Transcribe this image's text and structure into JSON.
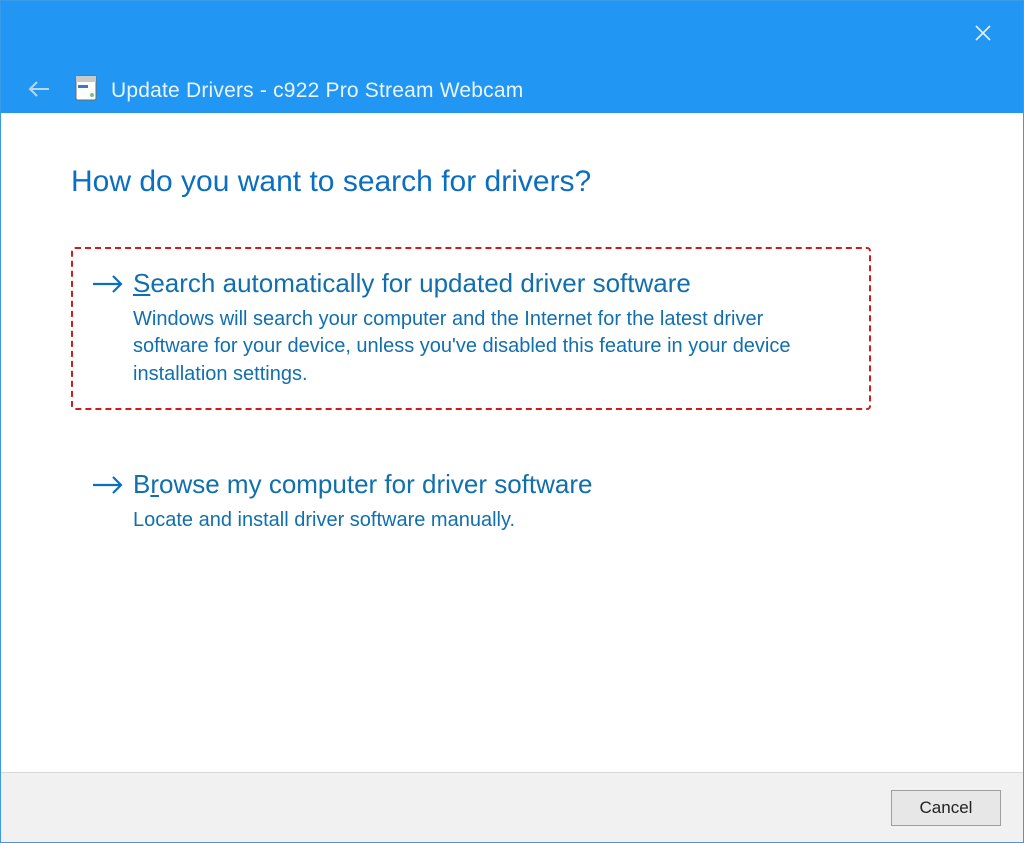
{
  "titlebar": {
    "title": "Update Drivers - c922 Pro Stream Webcam"
  },
  "heading": "How do you want to search for drivers?",
  "options": [
    {
      "accessKey": "S",
      "titleRest": "earch automatically for updated driver software",
      "description": "Windows will search your computer and the Internet for the latest driver software for your device, unless you've disabled this feature in your device installation settings.",
      "highlighted": true
    },
    {
      "accessKeyPrefix": "B",
      "accessKey": "r",
      "titleRest": "owse my computer for driver software",
      "description": "Locate and install driver software manually.",
      "highlighted": false
    }
  ],
  "footer": {
    "cancel": "Cancel"
  }
}
